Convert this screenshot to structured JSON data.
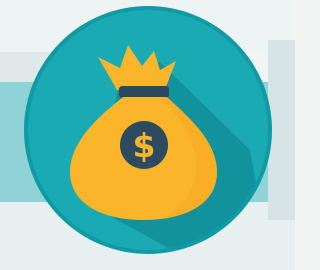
{
  "icon": {
    "name": "money-bag-icon",
    "symbol": "$",
    "colors": {
      "background_left_band": "#cfe2e6",
      "background_light": "#f1f4f4",
      "background_teal_band": "#8fd3d6",
      "circle_fill": "#1aaab4",
      "circle_rim": "#0f9aa5",
      "long_shadow": "#118e98",
      "bag_fill": "#fbb52a",
      "bag_dark": "#e09a14",
      "tie_band": "#2b4a5f",
      "coin_fill": "#2c4b60",
      "dollar_sign": "#fbb52a"
    }
  }
}
